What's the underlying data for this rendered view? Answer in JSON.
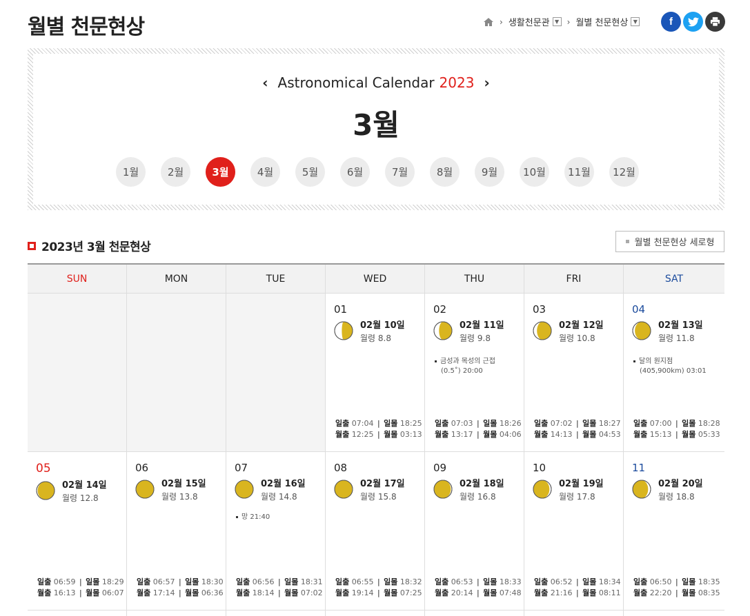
{
  "page_title": "월별 천문현상",
  "breadcrumb": {
    "home_icon": "home-icon",
    "items": [
      "생활천문관",
      "월별 천문현상"
    ]
  },
  "share": {
    "facebook": "f",
    "twitter": "twitter-icon",
    "print": "print-icon"
  },
  "calendar_header": {
    "title": "Astronomical Calendar",
    "year": "2023",
    "prev": "‹",
    "next": "›",
    "current_month": "3월"
  },
  "months": [
    "1월",
    "2월",
    "3월",
    "4월",
    "5월",
    "6월",
    "7월",
    "8월",
    "9월",
    "10월",
    "11월",
    "12월"
  ],
  "active_month_index": 2,
  "section_title": "2023년 3월 천문현상",
  "vertical_view_label": "월별 천문현상 세로형",
  "weekdays": [
    "SUN",
    "MON",
    "TUE",
    "WED",
    "THU",
    "FRI",
    "SAT"
  ],
  "labels": {
    "sunrise": "일출",
    "sunset": "일몰",
    "moonrise": "월출",
    "moonset": "월몰"
  },
  "colors": {
    "accent": "#e0201b",
    "saturday": "#1a4a9c",
    "moon": "#d9b51f"
  },
  "weeks": [
    [
      null,
      null,
      null,
      {
        "day": "01",
        "lunar": "02월 10일",
        "age": "월령 8.8",
        "phase": 0.3,
        "sunrise": "07:04",
        "sunset": "18:25",
        "moonrise": "12:25",
        "moonset": "03:13",
        "event": []
      },
      {
        "day": "02",
        "lunar": "02월 11일",
        "age": "월령 9.8",
        "phase": 0.36,
        "sunrise": "07:03",
        "sunset": "18:26",
        "moonrise": "13:17",
        "moonset": "04:06",
        "event": [
          "금성과 목성의 근접",
          "(0.5˚) 20:00"
        ]
      },
      {
        "day": "03",
        "lunar": "02월 12일",
        "age": "월령 10.8",
        "phase": 0.4,
        "sunrise": "07:02",
        "sunset": "18:27",
        "moonrise": "14:13",
        "moonset": "04:53",
        "event": []
      },
      {
        "day": "04",
        "lunar": "02월 13일",
        "age": "월령 11.8",
        "phase": 0.44,
        "sunrise": "07:00",
        "sunset": "18:28",
        "moonrise": "15:13",
        "moonset": "05:33",
        "event": [
          "달의 원지점",
          "(405,900km) 03:01"
        ]
      }
    ],
    [
      {
        "day": "05",
        "lunar": "02월 14일",
        "age": "월령 12.8",
        "phase": 0.47,
        "sunrise": "06:59",
        "sunset": "18:29",
        "moonrise": "16:13",
        "moonset": "06:07",
        "event": []
      },
      {
        "day": "06",
        "lunar": "02월 15일",
        "age": "월령 13.8",
        "phase": 0.49,
        "sunrise": "06:57",
        "sunset": "18:30",
        "moonrise": "17:14",
        "moonset": "06:36",
        "event": []
      },
      {
        "day": "07",
        "lunar": "02월 16일",
        "age": "월령 14.8",
        "phase": 0.5,
        "sunrise": "06:56",
        "sunset": "18:31",
        "moonrise": "18:14",
        "moonset": "07:02",
        "event": [
          "망 21:40"
        ]
      },
      {
        "day": "08",
        "lunar": "02월 17일",
        "age": "월령 15.8",
        "phase": 0.51,
        "sunrise": "06:55",
        "sunset": "18:32",
        "moonrise": "19:14",
        "moonset": "07:25",
        "event": []
      },
      {
        "day": "09",
        "lunar": "02월 18일",
        "age": "월령 16.8",
        "phase": 0.53,
        "sunrise": "06:53",
        "sunset": "18:33",
        "moonrise": "20:14",
        "moonset": "07:48",
        "event": []
      },
      {
        "day": "10",
        "lunar": "02월 19일",
        "age": "월령 17.8",
        "phase": 0.55,
        "sunrise": "06:52",
        "sunset": "18:34",
        "moonrise": "21:16",
        "moonset": "08:11",
        "event": []
      },
      {
        "day": "11",
        "lunar": "02월 20일",
        "age": "월령 18.8",
        "phase": 0.57,
        "sunrise": "06:50",
        "sunset": "18:35",
        "moonrise": "22:20",
        "moonset": "08:35",
        "event": []
      }
    ]
  ]
}
